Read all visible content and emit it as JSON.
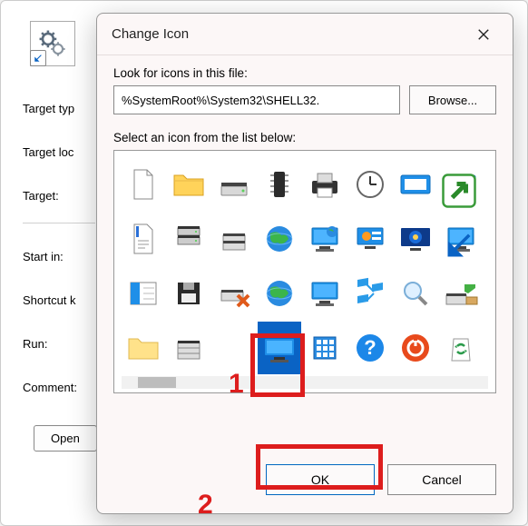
{
  "back": {
    "labels": {
      "target_type": "Target typ",
      "target_location": "Target loc",
      "target": "Target:",
      "start_in": "Start in:",
      "shortcut_key": "Shortcut k",
      "run": "Run:",
      "comment": "Comment:"
    },
    "open_button": "Open"
  },
  "dialog": {
    "title": "Change Icon",
    "lookfor_label": "Look for icons in this file:",
    "path_value": "%SystemRoot%\\System32\\SHELL32.",
    "browse_label": "Browse...",
    "select_label": "Select an icon from the list below:",
    "ok_label": "OK",
    "cancel_label": "Cancel",
    "icons": [
      [
        "blank-file",
        "folder",
        "hard-drive",
        "chip",
        "printer",
        "clock",
        "window-blue",
        "window-share"
      ],
      [
        "document-text",
        "server-stack",
        "drive-stack",
        "globe",
        "monitor-globe",
        "monitor-settings",
        "monitor-blue",
        "monitor-share"
      ],
      [
        "panel-layout",
        "floppy",
        "drive-delete",
        "globe-small",
        "monitor-small",
        "network-nodes",
        "magnifier",
        "drive-arrow"
      ],
      [
        "folder-empty",
        "drive-stack2",
        "-",
        "monitor-wide",
        "apps-grid",
        "help-circle",
        "power-circle",
        "recycle"
      ]
    ],
    "selected_icon": {
      "row": 3,
      "col": 3
    }
  },
  "annotations": {
    "one": "1",
    "two": "2"
  }
}
